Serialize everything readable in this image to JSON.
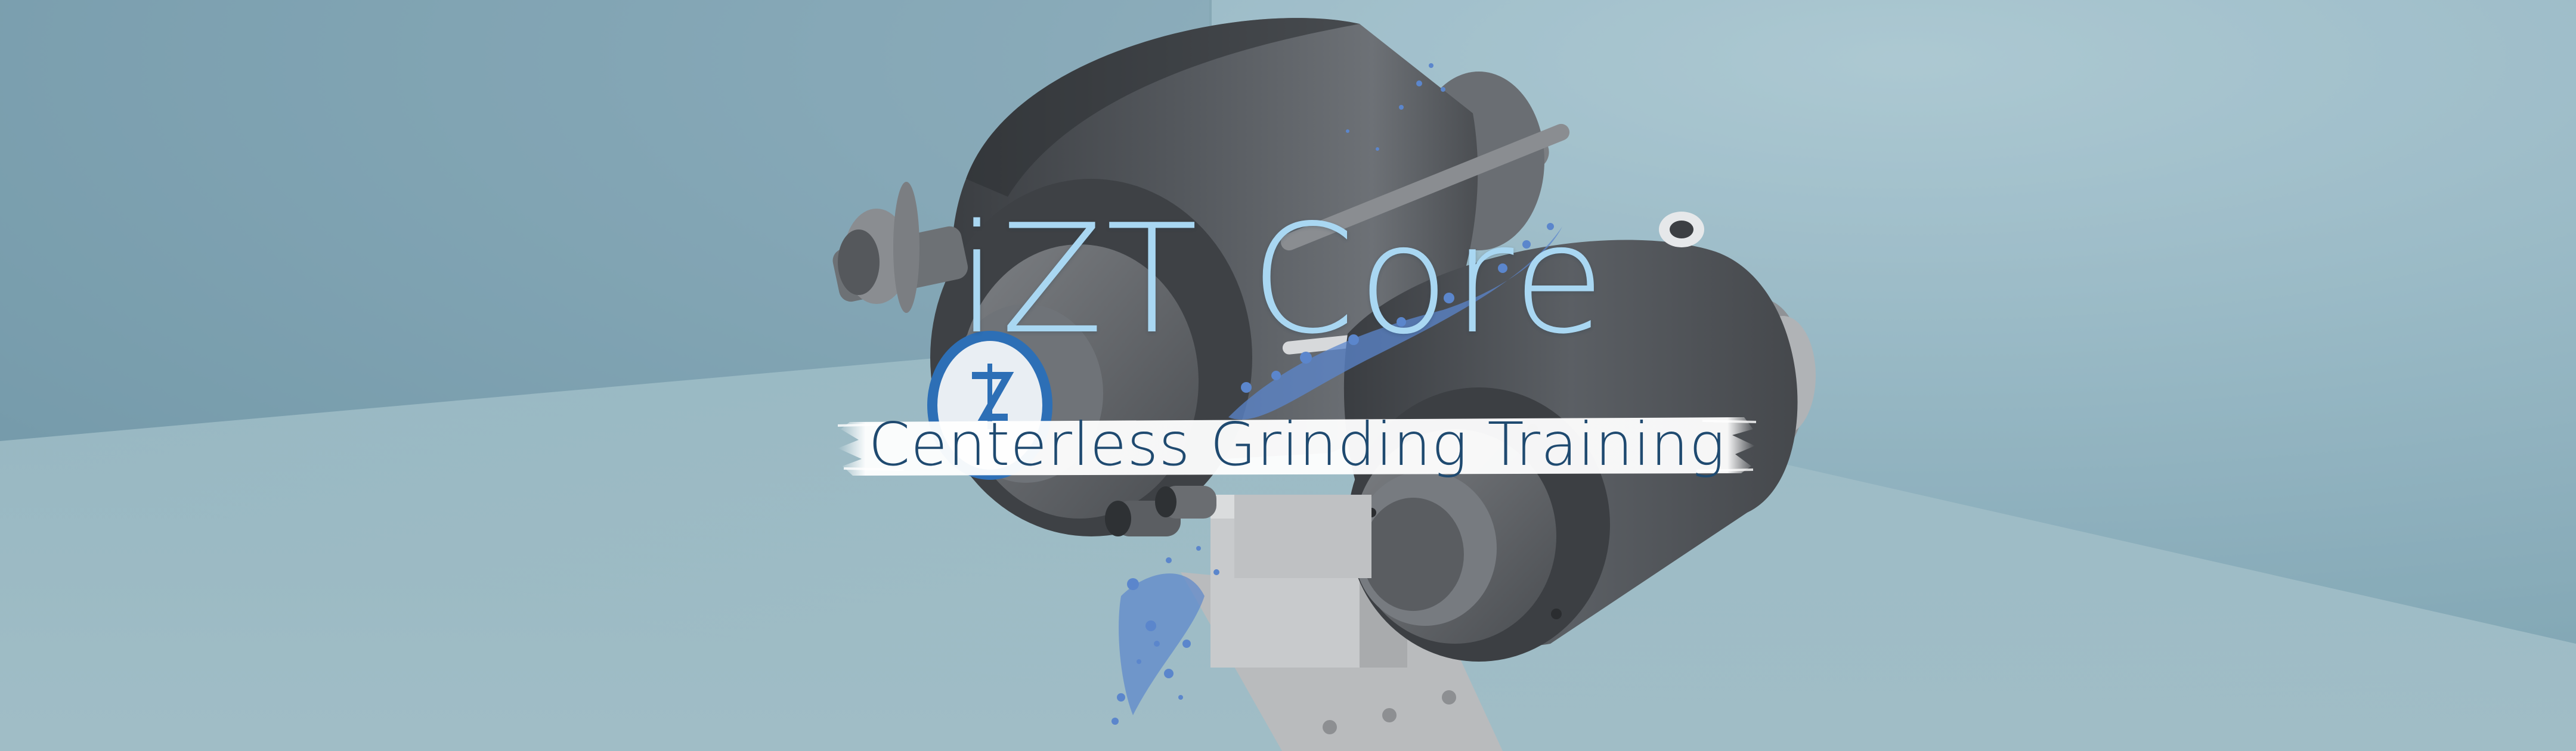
{
  "banner": {
    "title": "iZT Core",
    "subtitle": "Centerless Grinding Training",
    "logo_text": ""
  },
  "colors": {
    "background": "#8fb0bd",
    "title": "#a9d7f2",
    "subtitle": "#1f4a70",
    "subtitle_band": "#ffffff",
    "machine_dark": "#4a4d51",
    "machine_light": "#9a9c9f",
    "coolant": "#5b86cc"
  },
  "icons": [
    "grinding-wheel-illustration",
    "regulating-wheel-illustration",
    "coolant-splash-illustration",
    "logo-mark-icon"
  ]
}
